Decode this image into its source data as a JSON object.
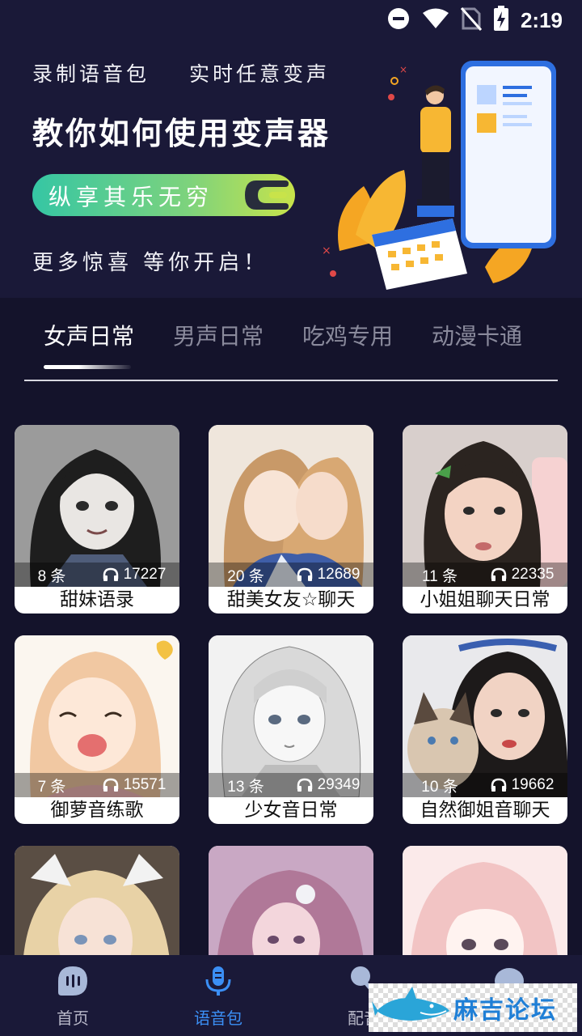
{
  "status_bar": {
    "time": "2:19"
  },
  "banner": {
    "subtitle_left": "录制语音包",
    "subtitle_right": "实时任意变声",
    "title": "教你如何使用变声器",
    "pill_text": "纵享其乐无穷",
    "footer": "更多惊喜 等你开启！"
  },
  "tabs": [
    {
      "label": "女声日常",
      "active": true
    },
    {
      "label": "男声日常",
      "active": false
    },
    {
      "label": "吃鸡专用",
      "active": false
    },
    {
      "label": "动漫卡通",
      "active": false
    }
  ],
  "cards": [
    {
      "title": "甜妹语录",
      "count": "8 条",
      "listens": "17227"
    },
    {
      "title": "甜美女友☆聊天",
      "count": "20 条",
      "listens": "12689"
    },
    {
      "title": "小姐姐聊天日常",
      "count": "11 条",
      "listens": "22335"
    },
    {
      "title": "御萝音练歌",
      "count": "7 条",
      "listens": "15571"
    },
    {
      "title": "少女音日常",
      "count": "13 条",
      "listens": "29349"
    },
    {
      "title": "自然御姐音聊天",
      "count": "10 条",
      "listens": "19662"
    },
    {
      "title": "",
      "count": "",
      "listens": ""
    },
    {
      "title": "",
      "count": "",
      "listens": ""
    },
    {
      "title": "",
      "count": "",
      "listens": ""
    }
  ],
  "bottom_nav": [
    {
      "label": "首页",
      "icon": "home-chat-icon",
      "active": false
    },
    {
      "label": "语音包",
      "icon": "microphone-icon",
      "active": true
    },
    {
      "label": "配音",
      "icon": "dubbing-icon",
      "active": false
    },
    {
      "label": "",
      "icon": "profile-icon",
      "active": false
    }
  ],
  "watermark": {
    "text": "麻吉论坛"
  },
  "colors": {
    "background": "#14132b",
    "banner": "#1a1938",
    "accent": "#3b8ff5",
    "pill_start": "#35c6a4",
    "pill_end": "#c8e34a"
  }
}
